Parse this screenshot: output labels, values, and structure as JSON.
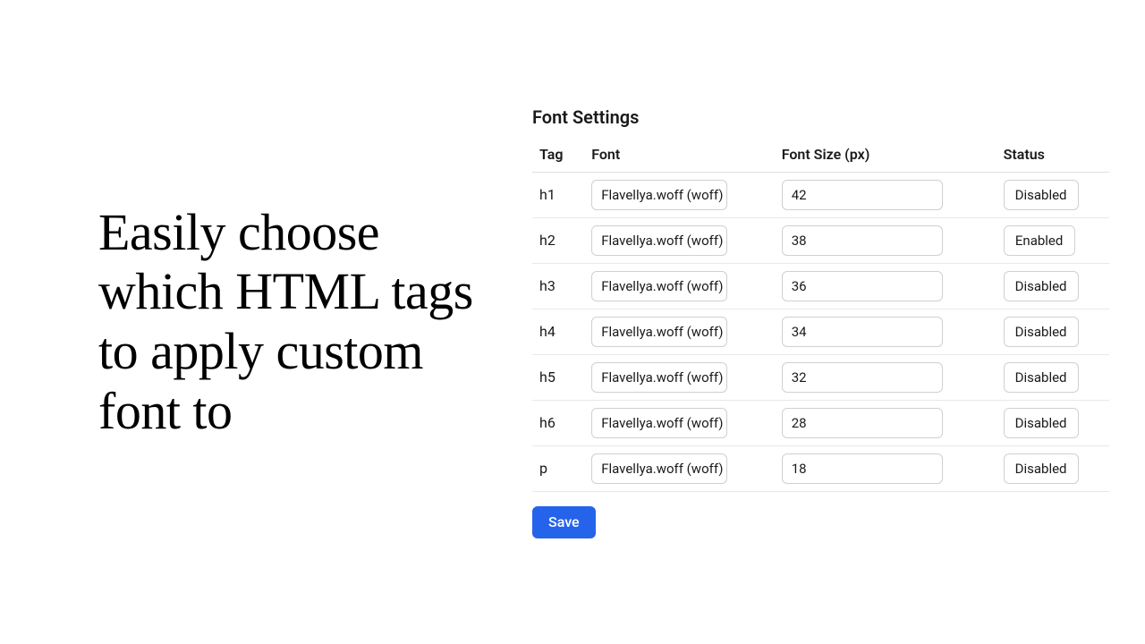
{
  "headline": "Easily choose which HTML tags to apply custom font to",
  "panel": {
    "title": "Font Settings",
    "columns": {
      "tag": "Tag",
      "font": "Font",
      "size": "Font Size (px)",
      "status": "Status"
    },
    "rows": [
      {
        "tag": "h1",
        "font": "Flavellya.woff (woff)",
        "size": "42",
        "status": "Disabled"
      },
      {
        "tag": "h2",
        "font": "Flavellya.woff (woff)",
        "size": "38",
        "status": "Enabled"
      },
      {
        "tag": "h3",
        "font": "Flavellya.woff (woff)",
        "size": "36",
        "status": "Disabled"
      },
      {
        "tag": "h4",
        "font": "Flavellya.woff (woff)",
        "size": "34",
        "status": "Disabled"
      },
      {
        "tag": "h5",
        "font": "Flavellya.woff (woff)",
        "size": "32",
        "status": "Disabled"
      },
      {
        "tag": "h6",
        "font": "Flavellya.woff (woff)",
        "size": "28",
        "status": "Disabled"
      },
      {
        "tag": "p",
        "font": "Flavellya.woff (woff)",
        "size": "18",
        "status": "Disabled"
      }
    ],
    "save_label": "Save"
  }
}
